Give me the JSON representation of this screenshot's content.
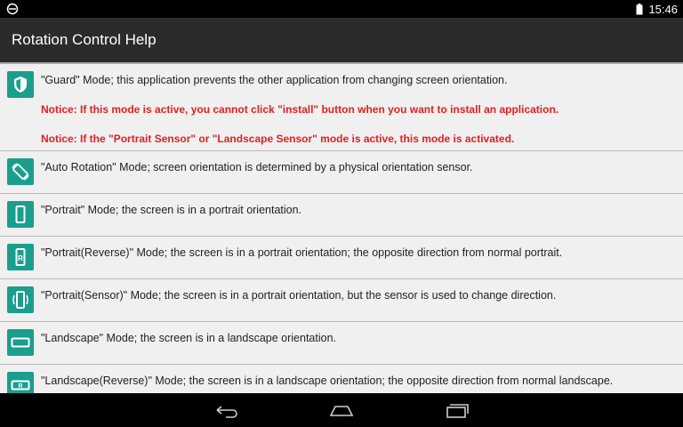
{
  "status": {
    "time": "15:46"
  },
  "header": {
    "title": "Rotation Control Help"
  },
  "items": [
    {
      "icon": "shield-icon",
      "text": "\"Guard\" Mode; this application prevents the other application from changing screen orientation.",
      "notices": [
        "Notice: If this mode is active, you cannot click \"install\" button when you want to install an application.",
        "Notice: If the \"Portrait Sensor\" or \"Landscape Sensor\" mode is active, this mode is activated."
      ]
    },
    {
      "icon": "auto-rotate-icon",
      "text": "\"Auto Rotation\" Mode; screen orientation is determined by a physical orientation sensor."
    },
    {
      "icon": "portrait-icon",
      "text": "\"Portrait\" Mode; the screen is in a portrait orientation."
    },
    {
      "icon": "portrait-reverse-icon",
      "text": "\"Portrait(Reverse)\" Mode; the screen is in a portrait orientation; the opposite direction from normal portrait.",
      "icon_letter": "R"
    },
    {
      "icon": "portrait-sensor-icon",
      "text": "\"Portrait(Sensor)\" Mode; the screen is in a portrait orientation, but the sensor is used to change direction."
    },
    {
      "icon": "landscape-icon",
      "text": "\"Landscape\" Mode; the screen is in a landscape orientation."
    },
    {
      "icon": "landscape-reverse-icon",
      "text": "\"Landscape(Reverse)\" Mode; the screen is in a landscape orientation; the opposite direction from normal landscape.",
      "icon_letter": "R"
    }
  ],
  "colors": {
    "accent": "#1a9e8e",
    "notice": "#e02020",
    "action_bar": "#2b2b2b"
  }
}
